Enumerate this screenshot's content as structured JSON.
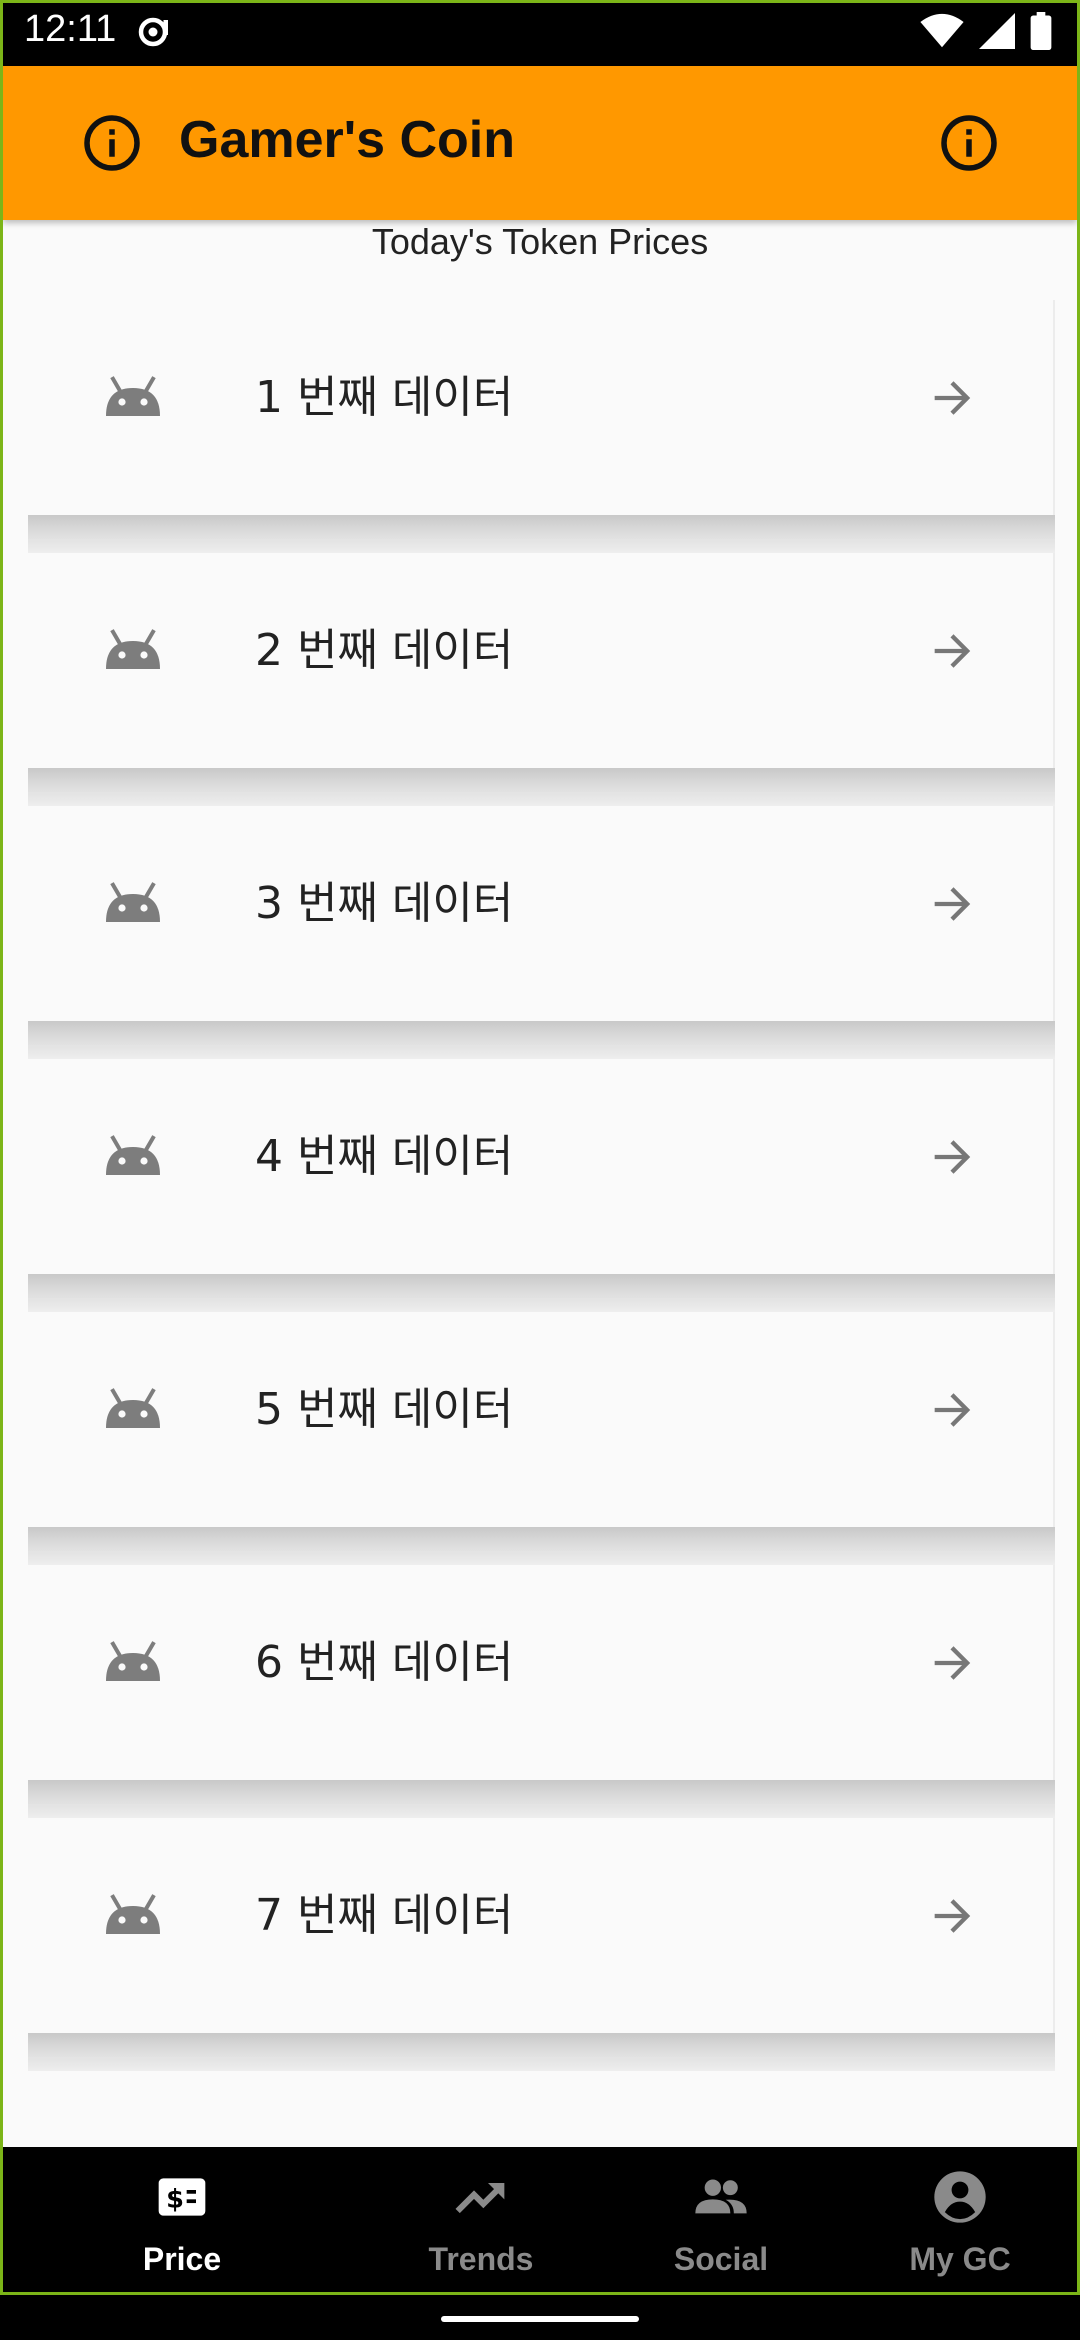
{
  "status_bar": {
    "time": "12:11",
    "icons": [
      "notification-icon",
      "wifi-icon",
      "signal-icon",
      "battery-icon"
    ]
  },
  "app_bar": {
    "title": "Gamer's Coin",
    "background_color": "#ff9800",
    "left_icon": "info-icon",
    "right_icon": "info-icon"
  },
  "main": {
    "subtitle": "Today's Token Prices",
    "items": [
      {
        "label": "1 번째 데이터",
        "leading_icon": "android-icon",
        "trailing_icon": "arrow-right-icon"
      },
      {
        "label": "2 번째 데이터",
        "leading_icon": "android-icon",
        "trailing_icon": "arrow-right-icon"
      },
      {
        "label": "3 번째 데이터",
        "leading_icon": "android-icon",
        "trailing_icon": "arrow-right-icon"
      },
      {
        "label": "4 번째 데이터",
        "leading_icon": "android-icon",
        "trailing_icon": "arrow-right-icon"
      },
      {
        "label": "5 번째 데이터",
        "leading_icon": "android-icon",
        "trailing_icon": "arrow-right-icon"
      },
      {
        "label": "6 번째 데이터",
        "leading_icon": "android-icon",
        "trailing_icon": "arrow-right-icon"
      },
      {
        "label": "7 번째 데이터",
        "leading_icon": "android-icon",
        "trailing_icon": "arrow-right-icon"
      }
    ]
  },
  "bottom_nav": {
    "items": [
      {
        "label": "Price",
        "icon": "price-tag-icon",
        "active": true
      },
      {
        "label": "Trends",
        "icon": "trending-up-icon",
        "active": false
      },
      {
        "label": "Social",
        "icon": "people-icon",
        "active": false
      },
      {
        "label": "My GC",
        "icon": "account-circle-icon",
        "active": false
      }
    ],
    "active_color": "#ffffff",
    "inactive_color": "#8a8a8a"
  }
}
